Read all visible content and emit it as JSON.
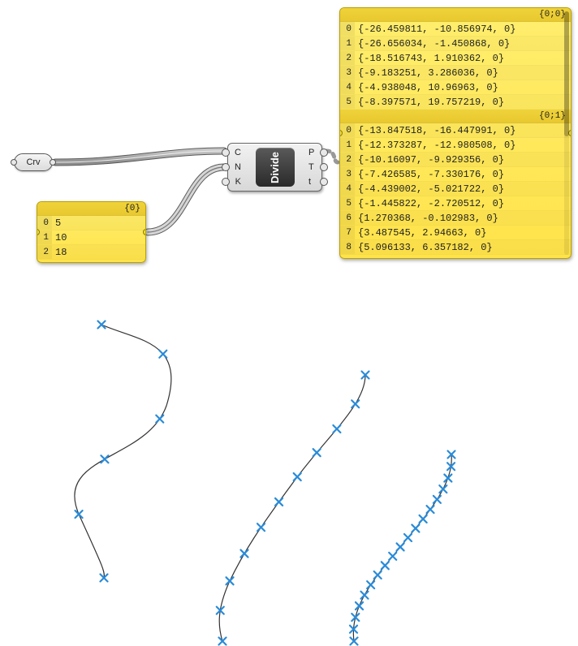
{
  "crv_param": {
    "label": "Crv"
  },
  "divide": {
    "name": "Divide",
    "inputs": [
      "C",
      "N",
      "K"
    ],
    "outputs": [
      "P",
      "T",
      "t"
    ]
  },
  "panel_small": {
    "path": "{0}",
    "rows": [
      {
        "idx": "0",
        "val": "5"
      },
      {
        "idx": "1",
        "val": "10"
      },
      {
        "idx": "2",
        "val": "18"
      }
    ]
  },
  "panel_big": {
    "branches": [
      {
        "path": "{0;0}",
        "rows": [
          {
            "idx": "0",
            "val": "{-26.459811, -10.856974, 0}"
          },
          {
            "idx": "1",
            "val": "{-26.656034, -1.450868, 0}"
          },
          {
            "idx": "2",
            "val": "{-18.516743, 1.910362, 0}"
          },
          {
            "idx": "3",
            "val": "{-9.183251, 3.286036, 0}"
          },
          {
            "idx": "4",
            "val": "{-4.938048, 10.96963, 0}"
          },
          {
            "idx": "5",
            "val": "{-8.397571, 19.757219, 0}"
          }
        ]
      },
      {
        "path": "{0;1}",
        "rows": [
          {
            "idx": "0",
            "val": "{-13.847518, -16.447991, 0}"
          },
          {
            "idx": "1",
            "val": "{-12.373287, -12.980508, 0}"
          },
          {
            "idx": "2",
            "val": "{-10.16097, -9.929356, 0}"
          },
          {
            "idx": "3",
            "val": "{-7.426585, -7.330176, 0}"
          },
          {
            "idx": "4",
            "val": "{-4.439002, -5.021722, 0}"
          },
          {
            "idx": "5",
            "val": "{-1.445822, -2.720512, 0}"
          },
          {
            "idx": "6",
            "val": "{1.270368, -0.102983, 0}"
          },
          {
            "idx": "7",
            "val": "{3.487545, 2.94663, 0}"
          },
          {
            "idx": "8",
            "val": "{5.096133, 6.357182, 0}"
          }
        ]
      }
    ]
  }
}
